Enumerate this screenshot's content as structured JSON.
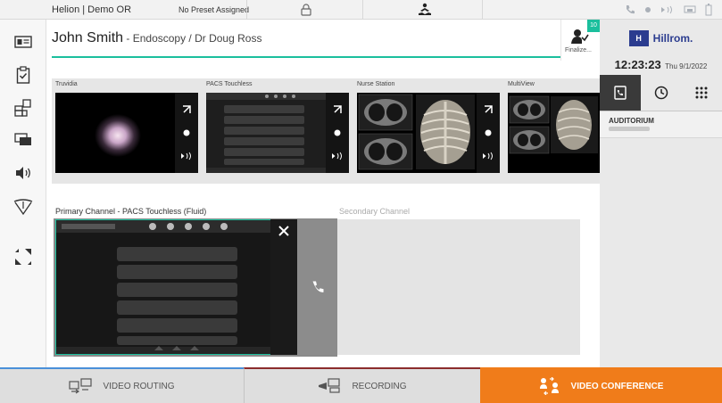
{
  "topbar": {
    "app_title": "Helion | Demo OR",
    "preset": "No Preset Assigned"
  },
  "patient": {
    "name": "John Smith",
    "procedure": " - Endoscopy / Dr Doug Ross"
  },
  "finalize": {
    "label": "Finalize...",
    "badge": "10"
  },
  "brand": {
    "logo_mark": "H",
    "name": "Hillrom."
  },
  "clock": {
    "time": "12:23:23",
    "date": "Thu 9/1/2022"
  },
  "sources": [
    {
      "label": "Truvidia"
    },
    {
      "label": "PACS Touchless"
    },
    {
      "label": "Nurse Station"
    },
    {
      "label": "MultiView"
    }
  ],
  "channels": {
    "primary_label": "Primary Channel - PACS Touchless (Fluid)",
    "secondary_label": "Secondary Channel"
  },
  "right_panel": {
    "tabs": [
      "phonebook-icon",
      "history-icon",
      "keypad-icon"
    ],
    "active_tab": 0,
    "contact_name": "AUDITORIUM"
  },
  "bottom_tabs": [
    {
      "label": "VIDEO ROUTING",
      "icon": "video-routing-icon"
    },
    {
      "label": "RECORDING",
      "icon": "recording-icon"
    },
    {
      "label": "VIDEO CONFERENCE",
      "icon": "video-conference-icon"
    }
  ],
  "colors": {
    "accent": "#1bbf9d",
    "conference": "#f07c1a",
    "brand": "#2b3c8f"
  }
}
